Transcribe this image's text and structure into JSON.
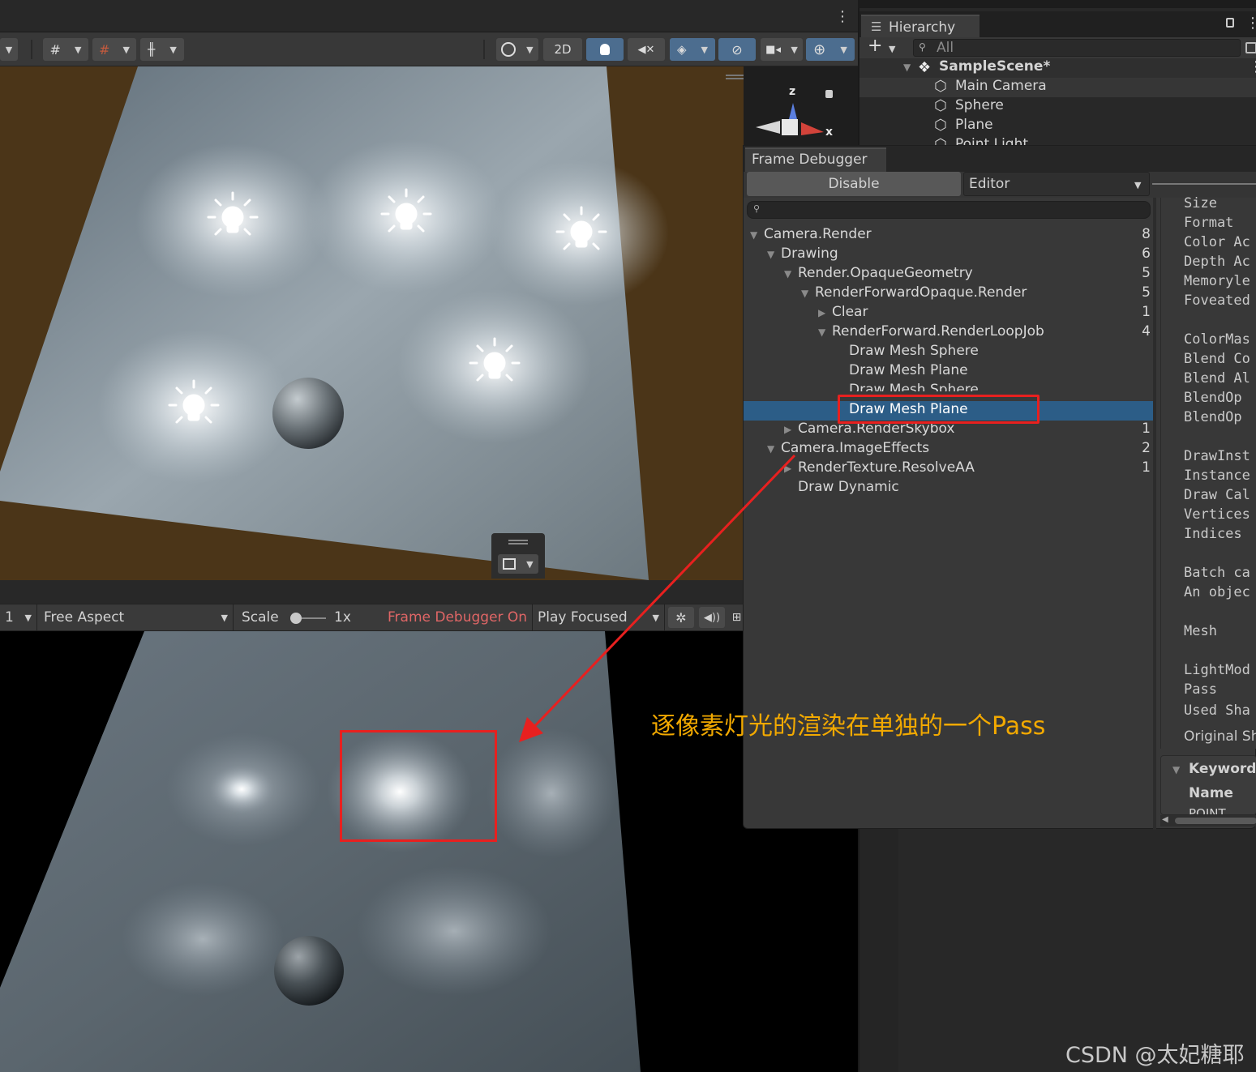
{
  "scene_toolbar": {
    "btn_2d": "2D"
  },
  "hierarchy": {
    "tab_label": "Hierarchy",
    "search_placeholder": "All",
    "scene_name": "SampleScene*",
    "items": [
      "Main Camera",
      "Sphere",
      "Plane",
      "Point Light"
    ]
  },
  "gizmo": {
    "z_label": "z",
    "x_label": "x"
  },
  "frame_debugger": {
    "tab_label": "Frame Debugger",
    "disable_button": "Disable",
    "target_dropdown": "Editor",
    "tree": [
      {
        "label": "Camera.Render",
        "count": "8"
      },
      {
        "label": "Drawing",
        "count": "6"
      },
      {
        "label": "Render.OpaqueGeometry",
        "count": "5"
      },
      {
        "label": "RenderForwardOpaque.Render",
        "count": "5"
      },
      {
        "label": "Clear",
        "count": "1"
      },
      {
        "label": "RenderForward.RenderLoopJob",
        "count": "4"
      },
      {
        "label": "Draw Mesh Sphere",
        "count": ""
      },
      {
        "label": "Draw Mesh Plane",
        "count": ""
      },
      {
        "label": "Draw Mesh Sphere",
        "count": ""
      },
      {
        "label": "Draw Mesh Plane",
        "count": ""
      },
      {
        "label": "Camera.RenderSkybox",
        "count": "1"
      },
      {
        "label": "Camera.ImageEffects",
        "count": "2"
      },
      {
        "label": "RenderTexture.ResolveAA",
        "count": "1"
      },
      {
        "label": "Draw Dynamic",
        "count": ""
      }
    ],
    "properties": [
      "Size",
      "Format",
      "Color Ac",
      "Depth Ac",
      "Memoryle",
      "Foveated",
      "ColorMas",
      "Blend Co",
      "Blend Al",
      "BlendOp",
      "BlendOp",
      "DrawInst",
      "Instance",
      "Draw Cal",
      "Vertices",
      "Indices",
      "Batch ca",
      "An objec",
      "Mesh",
      "LightMod",
      "Pass",
      "Used Sha",
      "Original Sh"
    ],
    "keywords_header": "Keywords",
    "keywords_name": "Name",
    "keywords_value": "POINT"
  },
  "game_toolbar": {
    "display": "1",
    "aspect": "Free Aspect",
    "scale_label": "Scale",
    "scale_value": "1x",
    "frame_debugger_status": "Frame Debugger On",
    "play_mode": "Play Focused"
  },
  "annotation": {
    "note": "逐像素灯光的渲染在单独的一个Pass",
    "color": "#f2a900",
    "box_color": "#e8201f"
  },
  "watermark": "CSDN @太妃糖耶"
}
